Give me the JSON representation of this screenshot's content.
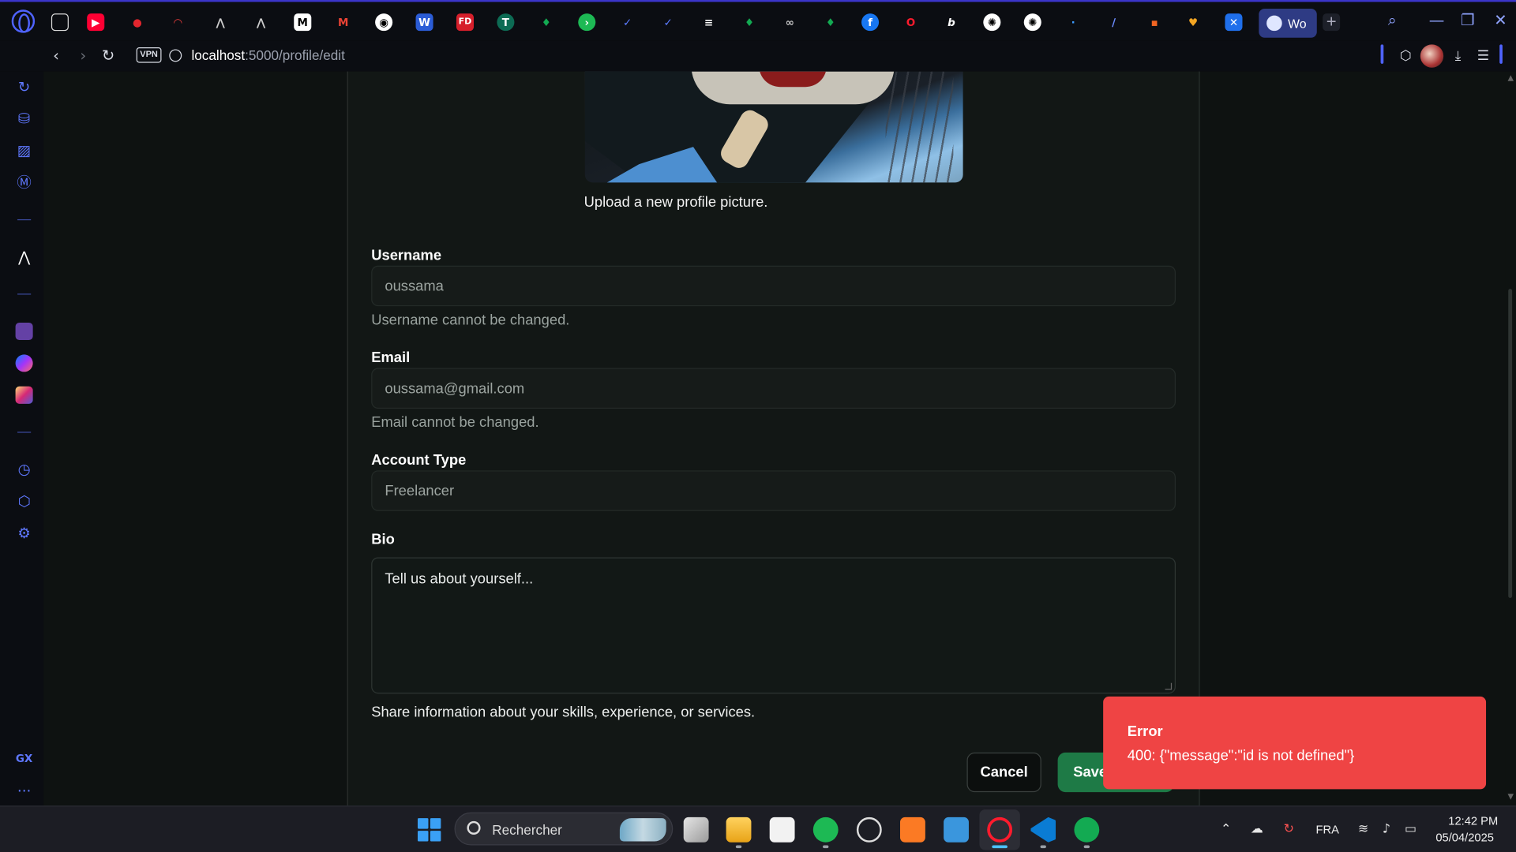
{
  "browser": {
    "active_tab_label": "Wo",
    "url_host": "localhost",
    "url_path": ":5000/profile/edit",
    "vpn_label": "VPN",
    "tab_icons": [
      "youtube-icon",
      "red-app-icon",
      "speedometer-icon",
      "tree-icon",
      "tree-icon",
      "twitch-like-icon",
      "gmail-icon",
      "github-icon",
      "word-icon",
      "fd-icon",
      "tracker-icon",
      "mongodb-icon",
      "circle-arrow-icon",
      "dragon-icon",
      "dragon-icon",
      "stack-icon",
      "mongodb-icon",
      "cluster-icon",
      "mongodb-icon",
      "facebook-icon",
      "opera-icon",
      "b-icon",
      "chatgpt-icon",
      "chatgpt-icon",
      "dot-icon",
      "pen-icon",
      "blocks-icon",
      "heart-icon",
      "butterfly-icon"
    ]
  },
  "sidebar": {
    "gx_label": "GX",
    "more_label": "···"
  },
  "profile_form": {
    "upload_hint": "Upload a new profile picture.",
    "username": {
      "label": "Username",
      "value": "oussama",
      "help": "Username cannot be changed."
    },
    "email": {
      "label": "Email",
      "value": "oussama@gmail.com",
      "help": "Email cannot be changed."
    },
    "account_type": {
      "label": "Account Type",
      "value": "Freelancer"
    },
    "bio": {
      "label": "Bio",
      "placeholder": "Tell us about yourself...",
      "help": "Share information about your skills, experience, or services."
    },
    "cancel_label": "Cancel",
    "save_label": "Save"
  },
  "toast": {
    "title": "Error",
    "message": "400: {\"message\":\"id is not defined\"}"
  },
  "taskbar": {
    "search_label": "Rechercher",
    "language": "FRA",
    "time": "12:42 PM",
    "date": "05/04/2025"
  },
  "colors": {
    "accent": "#4f63ff",
    "save_green": "#1e7a46",
    "error_red": "#ef4444"
  }
}
